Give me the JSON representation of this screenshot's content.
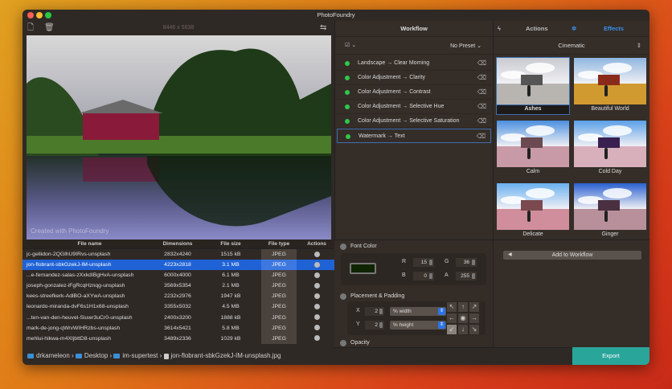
{
  "app": {
    "title": "PhotoFoundry"
  },
  "toolbar": {
    "dimensions": "8446 x 5638"
  },
  "preview": {
    "watermark": "Created with PhotoFoundry"
  },
  "table": {
    "headers": [
      "File name",
      "Dimensions",
      "File size",
      "File type",
      "Actions"
    ],
    "rows": [
      {
        "name": "jc-gellidon-2QGlhU9IRvs-unsplash",
        "dim": "2832x4240",
        "size": "1515 kB",
        "type": "JPEG"
      },
      {
        "name": "jon-flobrant-sbkGzekJ-IM-unsplash",
        "dim": "4223x2818",
        "size": "3.1 MB",
        "type": "JPEG",
        "selected": true
      },
      {
        "name": "...e-fernandez-salas-zXxkdIBgHvA-unsplash",
        "dim": "6000x4000",
        "size": "6.1 MB",
        "type": "JPEG"
      },
      {
        "name": "joseph-gonzalez-iFgRcqHznqg-unsplash",
        "dim": "3569x5354",
        "size": "2.1 MB",
        "type": "JPEG"
      },
      {
        "name": "kees-streefkerk-AdlBO-aXYwA-unsplash",
        "dim": "2232x2976",
        "size": "1947 kB",
        "type": "JPEG"
      },
      {
        "name": "leonardo-miranda-dvF6s1H1x68-unsplash",
        "dim": "3355x5032",
        "size": "4.5 MB",
        "type": "JPEG"
      },
      {
        "name": "...ten-van-den-heuvel-Siuwr3uCr0-unsplash",
        "dim": "2400x3200",
        "size": "1888 kB",
        "type": "JPEG"
      },
      {
        "name": "mark-de-jong-qWrvWIHRzbs-unsplash",
        "dim": "3614x5421",
        "size": "5.8 MB",
        "type": "JPEG"
      },
      {
        "name": "mehlui-hikwa-m4XIjbttD8-unsplash",
        "dim": "3489x2336",
        "size": "1029 kB",
        "type": "JPEG"
      }
    ]
  },
  "breadcrumb": [
    "drkameleon",
    "Desktop",
    "im-supertest",
    "jon-flobrant-sbkGzekJ-IM-unsplash.jpg"
  ],
  "workflow": {
    "title": "Workflow",
    "preset": "No Preset ⌄",
    "menu_icon": "☑ ⌄",
    "items": [
      "Landscape → Clear Morning",
      "Color Adjustment → Clarity",
      "Color Adjustment → Contrast",
      "Color Adjustment → Selective Hue",
      "Color Adjustment → Selective Saturation",
      "Watermark → Text"
    ]
  },
  "font_color": {
    "title": "Font Color",
    "swatch": "#0f2400",
    "R": "15",
    "G": "36",
    "B": "0",
    "A": "255",
    "labels": {
      "R": "R",
      "G": "G",
      "B": "B",
      "A": "A"
    }
  },
  "placement": {
    "title": "Placement & Padding",
    "x_label": "X",
    "x": "2",
    "x_unit": "% width",
    "y_label": "Y",
    "y": "2",
    "y_unit": "% height",
    "arrows": [
      "↖",
      "↑",
      "↗",
      "←",
      "◉",
      "→",
      "↙",
      "↓",
      "↘"
    ]
  },
  "opacity": {
    "title": "Opacity"
  },
  "right": {
    "tabs": {
      "actions": "Actions",
      "effects": "Effects"
    },
    "category": "Cinematic",
    "effects": [
      {
        "name": "Ashes",
        "sky": "#c8cad0",
        "ground": "#b8b4b0",
        "bld": "#555",
        "selected": true
      },
      {
        "name": "Beautiful World",
        "sky": "#8fb6e0",
        "ground": "#d09a30",
        "bld": "#8a2a1a"
      },
      {
        "name": "Calm",
        "sky": "#4a90e0",
        "ground": "#c89aa8",
        "bld": "#6a4a50"
      },
      {
        "name": "Cold Day",
        "sky": "#5aa0e8",
        "ground": "#d8b0bc",
        "bld": "#3a2050"
      },
      {
        "name": "Delicate",
        "sky": "#6ab0f0",
        "ground": "#d08e9c",
        "bld": "#7a4a50"
      },
      {
        "name": "Ginger",
        "sky": "#2a60d0",
        "ground": "#b8909c",
        "bld": "#4a3040"
      }
    ],
    "add_button": "Add to Workflow"
  },
  "export": "Export",
  "colors": {
    "accent": "#1f62d6",
    "export": "#2aa59a"
  }
}
